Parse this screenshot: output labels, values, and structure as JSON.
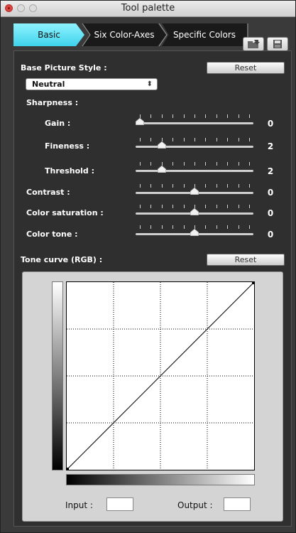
{
  "window": {
    "title": "Tool palette"
  },
  "tabs": [
    {
      "label": "Basic",
      "active": true
    },
    {
      "label": "Six Color-Axes",
      "active": false
    },
    {
      "label": "Specific Colors",
      "active": false
    }
  ],
  "toolbar": {
    "load_icon": "load-icon",
    "save_icon": "save-icon"
  },
  "picture_style": {
    "label": "Base Picture Style :",
    "reset_label": "Reset",
    "selected": "Neutral",
    "select_arrows": "⬍"
  },
  "sharpness": {
    "label": "Sharpness :",
    "gain": {
      "label": "Gain :",
      "value": "0",
      "position": 0.0
    },
    "fineness": {
      "label": "Fineness :",
      "value": "2",
      "position": 0.2
    },
    "threshold": {
      "label": "Threshold :",
      "value": "2",
      "position": 0.2
    }
  },
  "contrast": {
    "label": "Contrast :",
    "value": "0",
    "position": 0.5
  },
  "saturation": {
    "label": "Color saturation :",
    "value": "0",
    "position": 0.5
  },
  "tone": {
    "label": "Color tone :",
    "value": "0",
    "position": 0.5
  },
  "tone_curve": {
    "label": "Tone curve (RGB) :",
    "reset_label": "Reset",
    "input_label": "Input :",
    "output_label": "Output :",
    "input_value": "",
    "output_value": ""
  },
  "colors": {
    "tab_active": "#3fd3ec",
    "panel": "#2f2f2f",
    "close": "#e0443e"
  }
}
